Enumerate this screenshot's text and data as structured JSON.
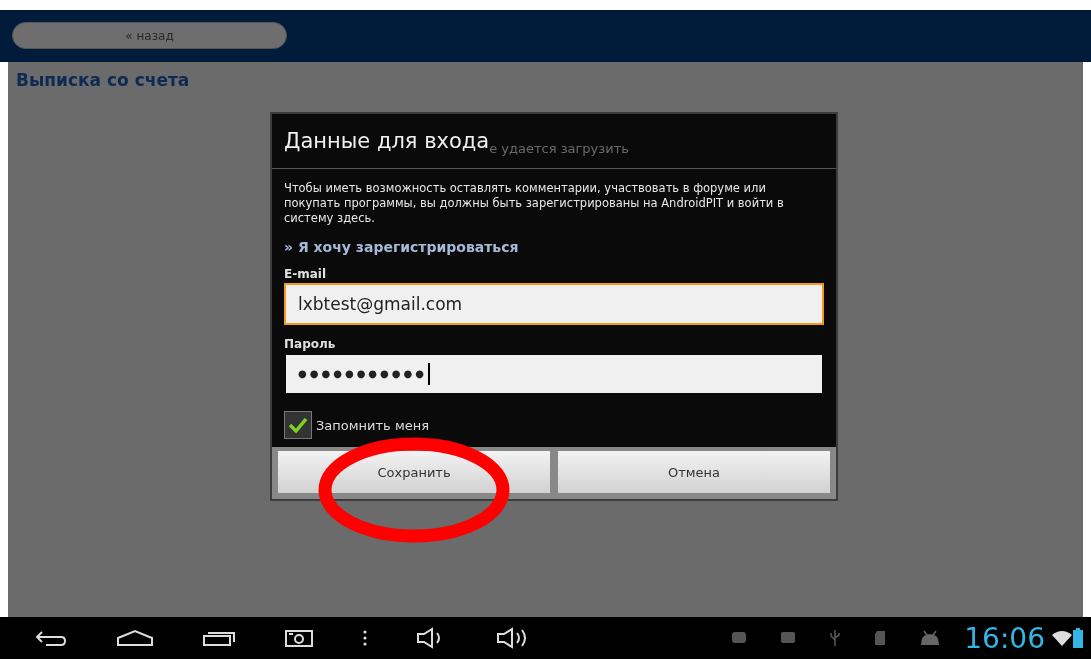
{
  "header": {
    "back_button": "« назад"
  },
  "page": {
    "title": "Выписка со счета",
    "background_message": "е удается загрузить"
  },
  "dialog": {
    "title": "Данные для входа",
    "description": "Чтобы иметь возможность оставлять комментарии, участвовать в форуме или покупать программы, вы должны быть зарегистрированы на AndroidPIT и войти в систему здесь.",
    "register_link": "» Я хочу зарегистрироваться",
    "fields": [
      {
        "label": "E-mail",
        "value": "lxbtest@gmail.com",
        "focused": true
      },
      {
        "label": "Пароль",
        "value": "●●●●●●●●●●●",
        "focused": false
      }
    ],
    "remember": {
      "label": "Запомнить меня",
      "checked": true
    },
    "buttons": [
      {
        "label": "Сохранить",
        "highlighted": true
      },
      {
        "label": "Отмена",
        "highlighted": false
      }
    ]
  },
  "status_bar": {
    "time": "16:06"
  }
}
